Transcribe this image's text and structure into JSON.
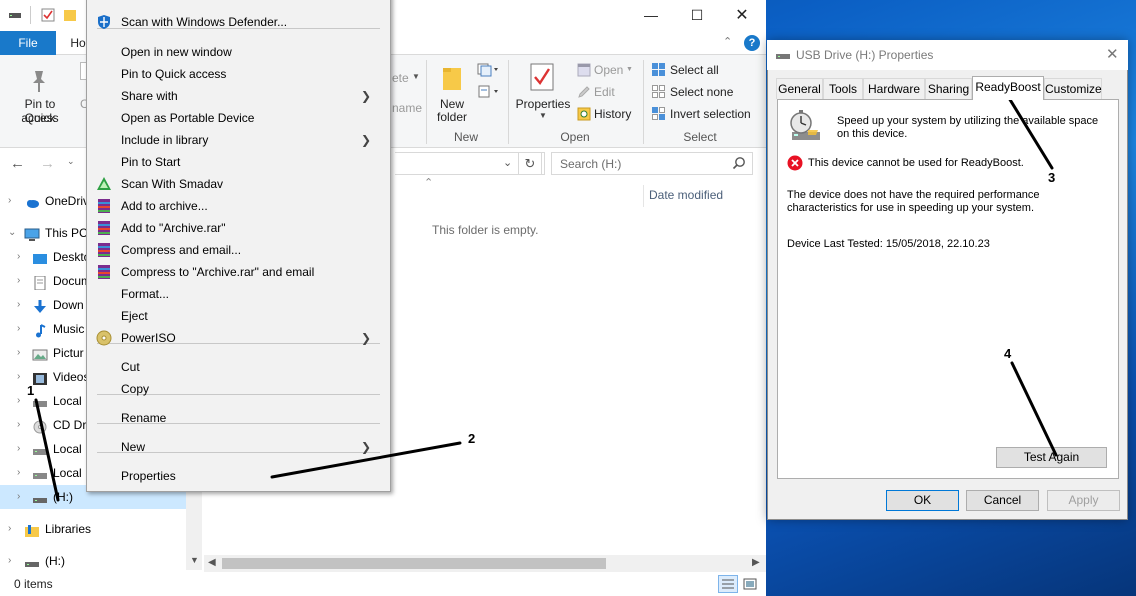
{
  "explorer": {
    "file_tab": "File",
    "home_tab": "Ho",
    "ribbon": {
      "pin_quick_access_line1": "Pin to Quick",
      "pin_quick_access_line2": "access",
      "clip_partial": "C",
      "delete_partial": "ete",
      "rename_partial": "name",
      "new_folder_line1": "New",
      "new_folder_line2": "folder",
      "group_new": "New",
      "properties": "Properties",
      "open": "Open",
      "edit": "Edit",
      "history": "History",
      "group_open": "Open",
      "select_all": "Select all",
      "select_none": "Select none",
      "invert_selection": "Invert selection",
      "group_select": "Select"
    },
    "search_placeholder": "Search  (H:)",
    "column_date_modified": "Date modified",
    "empty_message": "This folder is empty.",
    "status_items": "0 items",
    "nav": [
      {
        "label": "OneDriv",
        "icon": "cloud-icon"
      },
      {
        "label": "This PC",
        "icon": "computer-icon"
      },
      {
        "label": "Deskto",
        "icon": "desktop-icon"
      },
      {
        "label": "Docum",
        "icon": "document-icon"
      },
      {
        "label": "Down",
        "icon": "download-icon"
      },
      {
        "label": "Music",
        "icon": "music-icon"
      },
      {
        "label": "Pictur",
        "icon": "picture-icon"
      },
      {
        "label": "Videos",
        "icon": "video-icon"
      },
      {
        "label": "Local",
        "icon": "drive-icon"
      },
      {
        "label": "CD Dr",
        "icon": "cd-drive-icon"
      },
      {
        "label": "Local",
        "icon": "drive-icon"
      },
      {
        "label": "Local",
        "icon": "drive-icon"
      },
      {
        "label": "(H:)",
        "icon": "usb-drive-icon"
      },
      {
        "label": "Libraries",
        "icon": "libraries-icon"
      },
      {
        "label": "(H:)",
        "icon": "usb-drive-icon"
      }
    ]
  },
  "context_menu": {
    "items": [
      "Scan with Windows Defender...",
      "Open in new window",
      "Pin to Quick access",
      "Share with",
      "Open as Portable Device",
      "Include in library",
      "Pin to Start",
      "Scan With Smadav",
      "Add to archive...",
      "Add to \"Archive.rar\"",
      "Compress and email...",
      "Compress to \"Archive.rar\" and email",
      "Format...",
      "Eject",
      "PowerISO",
      "Cut",
      "Copy",
      "Rename",
      "New",
      "Properties"
    ]
  },
  "dialog": {
    "title": "USB Drive (H:) Properties",
    "tabs": [
      "General",
      "Tools",
      "Hardware",
      "Sharing",
      "ReadyBoost",
      "Customize"
    ],
    "active_tab": "ReadyBoost",
    "intro": "Speed up your system by utilizing the available space on this device.",
    "error": "This device cannot be used for ReadyBoost.",
    "reason": "The device does not have the required performance characteristics for use in speeding up your system.",
    "last_tested": "Device Last Tested: 15/05/2018, 22.10.23",
    "test_again": "Test Again",
    "ok": "OK",
    "cancel": "Cancel",
    "apply": "Apply"
  },
  "annotations": [
    "1",
    "2",
    "3",
    "4"
  ],
  "colors": {
    "file_tab": "#1979ca",
    "selection": "#cce8ff",
    "error_red": "#e81123",
    "desktop_blue": "#0b5fc4"
  }
}
